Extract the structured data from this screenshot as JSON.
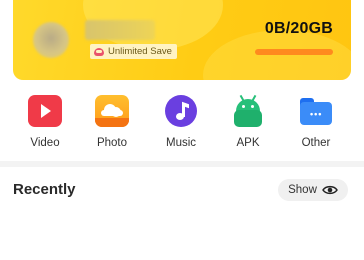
{
  "account": {
    "badge_label": "Unlimited Save",
    "badge_icon": "crown-icon",
    "storage_text": "0B/20GB",
    "storage_used_fraction": 0.0,
    "colors": {
      "card": "#ffcc14",
      "bar_track": "#ff8a1e",
      "badge_bg": "#fff3c2"
    }
  },
  "categories": [
    {
      "label": "Video",
      "icon": "video-icon",
      "color": "#f03a48"
    },
    {
      "label": "Photo",
      "icon": "photo-icon",
      "color": "#ffa51f"
    },
    {
      "label": "Music",
      "icon": "music-icon",
      "color": "#6a3fe0"
    },
    {
      "label": "APK",
      "icon": "android-icon",
      "color": "#27c07a"
    },
    {
      "label": "Other",
      "icon": "folder-icon",
      "color": "#3b8cf8"
    }
  ],
  "recently": {
    "title": "Recently",
    "show_label": "Show",
    "show_icon": "eye-icon"
  }
}
